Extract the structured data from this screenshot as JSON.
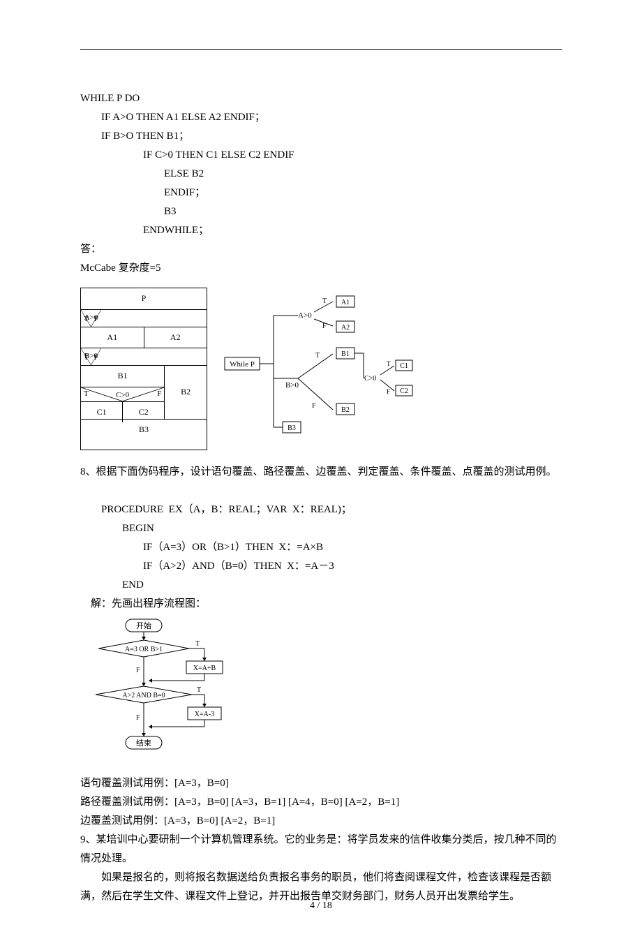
{
  "code1": {
    "l1": "WHILE P DO",
    "l2": "IF A>O THEN A1 ELSE A2 ENDIF；",
    "l3": "IF B>O THEN B1；",
    "l4": "IF C>0 THEN C1 ELSE C2 ENDIF",
    "l5": "ELSE B2",
    "l6": "ENDIF；",
    "l7": "B3",
    "l8": "ENDWHILE；"
  },
  "ans": "答：",
  "mccabe": "McCabe 复杂度=5",
  "ns": {
    "p": "P",
    "a0": "A>0",
    "a1": "A1",
    "a2": "A2",
    "b0": "B>0",
    "b1": "B1",
    "b2": "B2",
    "b3": "B3",
    "c0": "C>0",
    "c1": "C1",
    "c2": "C2",
    "t": "T",
    "f": "F"
  },
  "tree": {
    "while": "While P",
    "a0": "A>0",
    "a1": "A1",
    "a2": "A2",
    "b0": "B>0",
    "b1": "B1",
    "b2": "B2",
    "b3": "B3",
    "c0": "C>0",
    "c1": "C1",
    "c2": "C2",
    "t": "T",
    "f": "F"
  },
  "q8": "8、根据下面伪码程序，设计语句覆盖、路径覆盖、边覆盖、判定覆盖、条件覆盖、点覆盖的测试用例。",
  "code2": {
    "l1": "PROCEDURE  EX（A，B：REAL；VAR  X：REAL)；",
    "l2": "BEGIN",
    "l3": "IF（A=3）OR（B>1）THEN  X：=A×B",
    "l4": "IF（A>2）AND（B=0）THEN  X：=A－3",
    "l5": "END"
  },
  "sol": "解：先画出程序流程图：",
  "fc": {
    "start": "开始",
    "d1": "A=3 OR B>1",
    "x1": "X=A+B",
    "d2": "A>2 AND B=0",
    "x2": "X=A-3",
    "end": "结束",
    "t": "T",
    "f": "F"
  },
  "r1": "语句覆盖测试用例：[A=3，B=0]",
  "r2": "路径覆盖测试用例：[A=3，B=0] [A=3，B=1] [A=4，B=0] [A=2，B=1]",
  "r3": "边覆盖测试用例：[A=3，B=0] [A=2，B=1]",
  "q9": "9、某培训中心要研制一个计算机管理系统。它的业务是：将学员发来的信件收集分类后，按几种不同的情况处理。",
  "q9p": "如果是报名的，则将报名数据送给负责报名事务的职员，他们将查阅课程文件，检查该课程是否额满，然后在学生文件、课程文件上登记，并开出报告单交财务部门，财务人员开出发票给学生。",
  "page": "4 / 18"
}
